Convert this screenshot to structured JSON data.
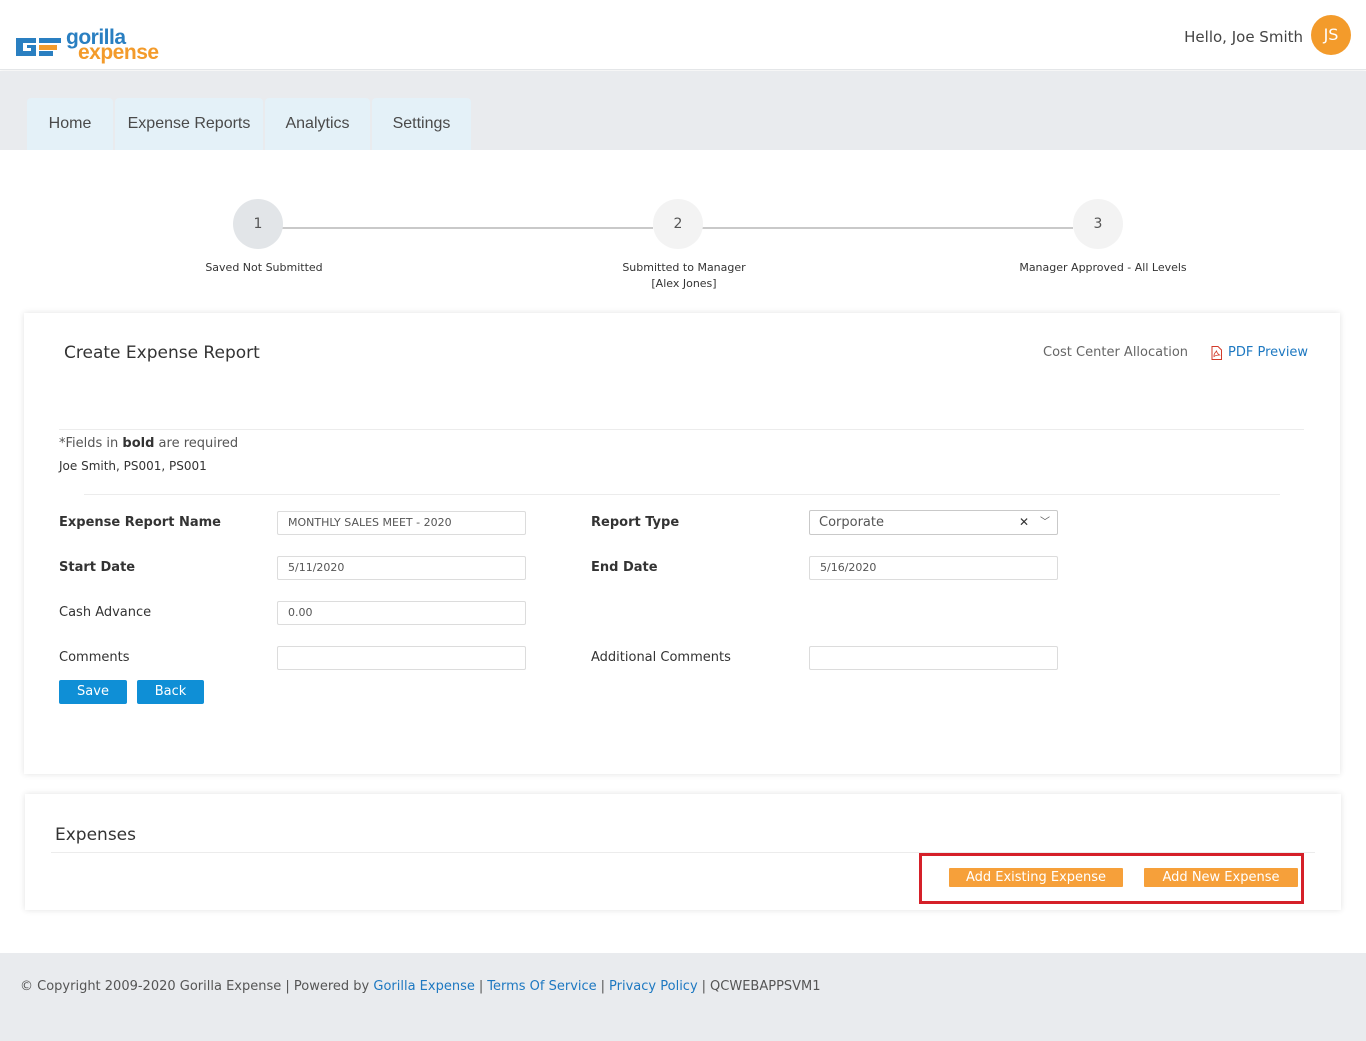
{
  "brand": {
    "logo_word1": "gorilla",
    "logo_word2": "expense",
    "accent": "#f39b2b",
    "blue": "#2a7fc1"
  },
  "header": {
    "greeting": "Hello, Joe Smith",
    "avatar_initials": "JS"
  },
  "nav": {
    "tabs": [
      {
        "label": "Home"
      },
      {
        "label": "Expense Reports"
      },
      {
        "label": "Analytics"
      },
      {
        "label": "Settings"
      }
    ]
  },
  "stepper": {
    "steps": [
      {
        "number": "1",
        "label": "Saved Not Submitted",
        "label2": ""
      },
      {
        "number": "2",
        "label": "Submitted to Manager",
        "label2": "[Alex Jones]"
      },
      {
        "number": "3",
        "label": "Manager Approved - All Levels",
        "label2": ""
      }
    ]
  },
  "report": {
    "title": "Create Expense Report",
    "cost_center_link": "Cost Center Allocation",
    "pdf_preview_link": "PDF Preview",
    "required_prefix": "*Fields in ",
    "required_bold": "bold",
    "required_suffix": " are required",
    "owner": "Joe Smith, PS001, PS001",
    "fields": {
      "name_label": "Expense Report Name",
      "name_value": "MONTHLY SALES MEET - 2020",
      "type_label": "Report Type",
      "type_value": "Corporate",
      "start_label": "Start Date",
      "start_value": "5/11/2020",
      "end_label": "End Date",
      "end_value": "5/16/2020",
      "cash_label": "Cash Advance",
      "cash_value": "0.00",
      "comments_label": "Comments",
      "comments_value": "",
      "add_comments_label": "Additional Comments",
      "add_comments_value": ""
    },
    "save_label": "Save",
    "back_label": "Back"
  },
  "expenses": {
    "title": "Expenses",
    "add_existing_label": "Add Existing Expense",
    "add_new_label": "Add New Expense"
  },
  "footer": {
    "copyright": "© Copyright 2009-2020 Gorilla Expense | Powered by ",
    "powered_link": "Gorilla Expense",
    "terms_link": "Terms Of Service",
    "privacy_link": "Privacy Policy",
    "server": "QCWEBAPPSVM1"
  }
}
